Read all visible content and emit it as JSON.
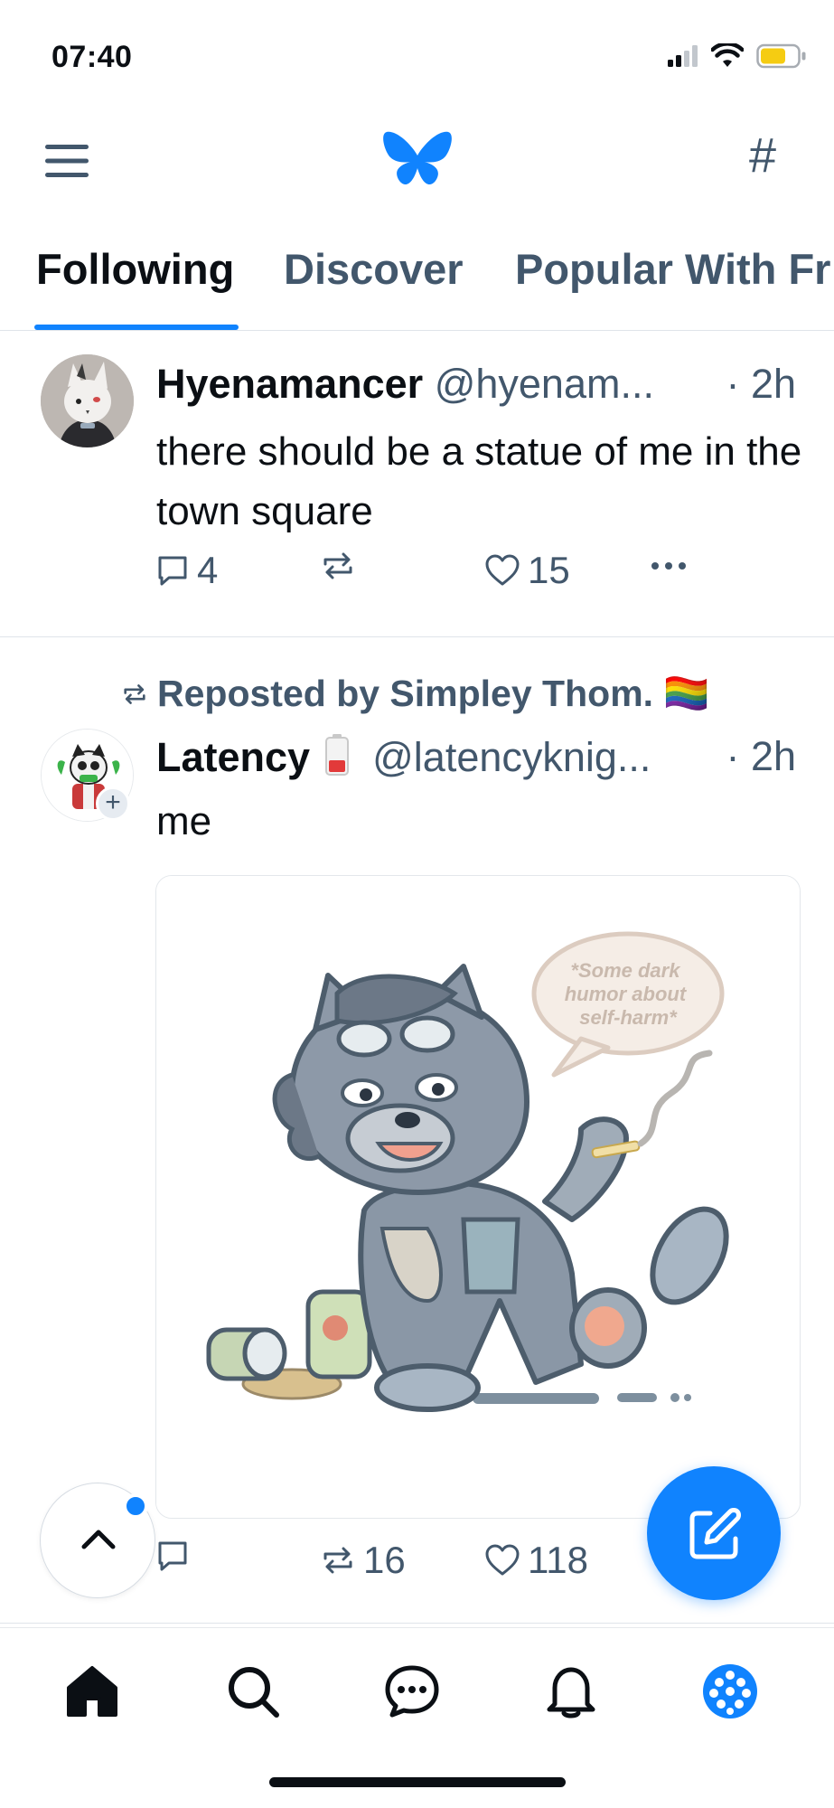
{
  "status_bar": {
    "time": "07:40",
    "icons": [
      "cellular-signal-icon",
      "wifi-icon",
      "battery-icon"
    ]
  },
  "top_nav": {
    "menu_icon": "hamburger-menu-icon",
    "logo_icon": "butterfly-logo-icon",
    "hashtag_label": "#"
  },
  "tabs": [
    {
      "label": "Following",
      "active": true
    },
    {
      "label": "Discover",
      "active": false
    },
    {
      "label": "Popular With Fr",
      "active": false
    }
  ],
  "posts": [
    {
      "author": "Hyenamancer",
      "handle": "@hyenam...",
      "time": "· 2h",
      "text": "there should be a statue of me in the town square",
      "replies": "4",
      "reposts": "",
      "likes": "15"
    },
    {
      "reposted_by": "Reposted by Simpley Thom. 🏳️‍🌈",
      "author": "Latency",
      "handle": "@latencyknig...",
      "time": "· 2h",
      "text": "me",
      "image_caption": "*Some dark humor about self-harm*",
      "replies": "",
      "reposts": "16",
      "likes": "118"
    }
  ],
  "bottom_nav": [
    "home-icon",
    "search-icon",
    "chat-icon",
    "bell-icon",
    "feeds-icon"
  ],
  "colors": {
    "accent": "#1083fe",
    "muted": "#42576c",
    "text": "#0b0f14",
    "divider": "#dfe4ea"
  }
}
